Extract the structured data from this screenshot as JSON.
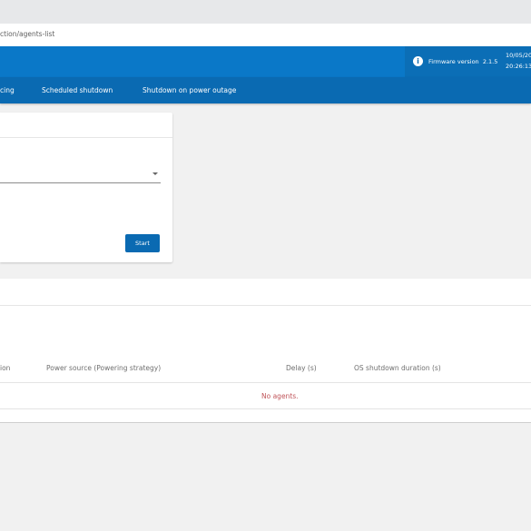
{
  "browser": {
    "address_text": "ction/agents-list"
  },
  "header": {
    "firmware_label": "Firmware version",
    "firmware_version": "2.1.5",
    "date": "10/05/20",
    "time": "20:26:13"
  },
  "nav": {
    "items": [
      {
        "label": "cing"
      },
      {
        "label": "Scheduled shutdown"
      },
      {
        "label": "Shutdown on power outage"
      }
    ]
  },
  "card": {
    "start_label": "Start"
  },
  "table": {
    "columns": [
      "ion",
      "Power source (Powering strategy)",
      "Delay (s)",
      "OS shutdown duration (s)"
    ],
    "empty_message": "No agents."
  },
  "icons": {
    "info": "info-icon",
    "dropdown": "chevron-down-icon"
  },
  "colors": {
    "primary": "#0a78c8",
    "nav": "#0a6ab2",
    "empty_text": "#c0555a"
  }
}
